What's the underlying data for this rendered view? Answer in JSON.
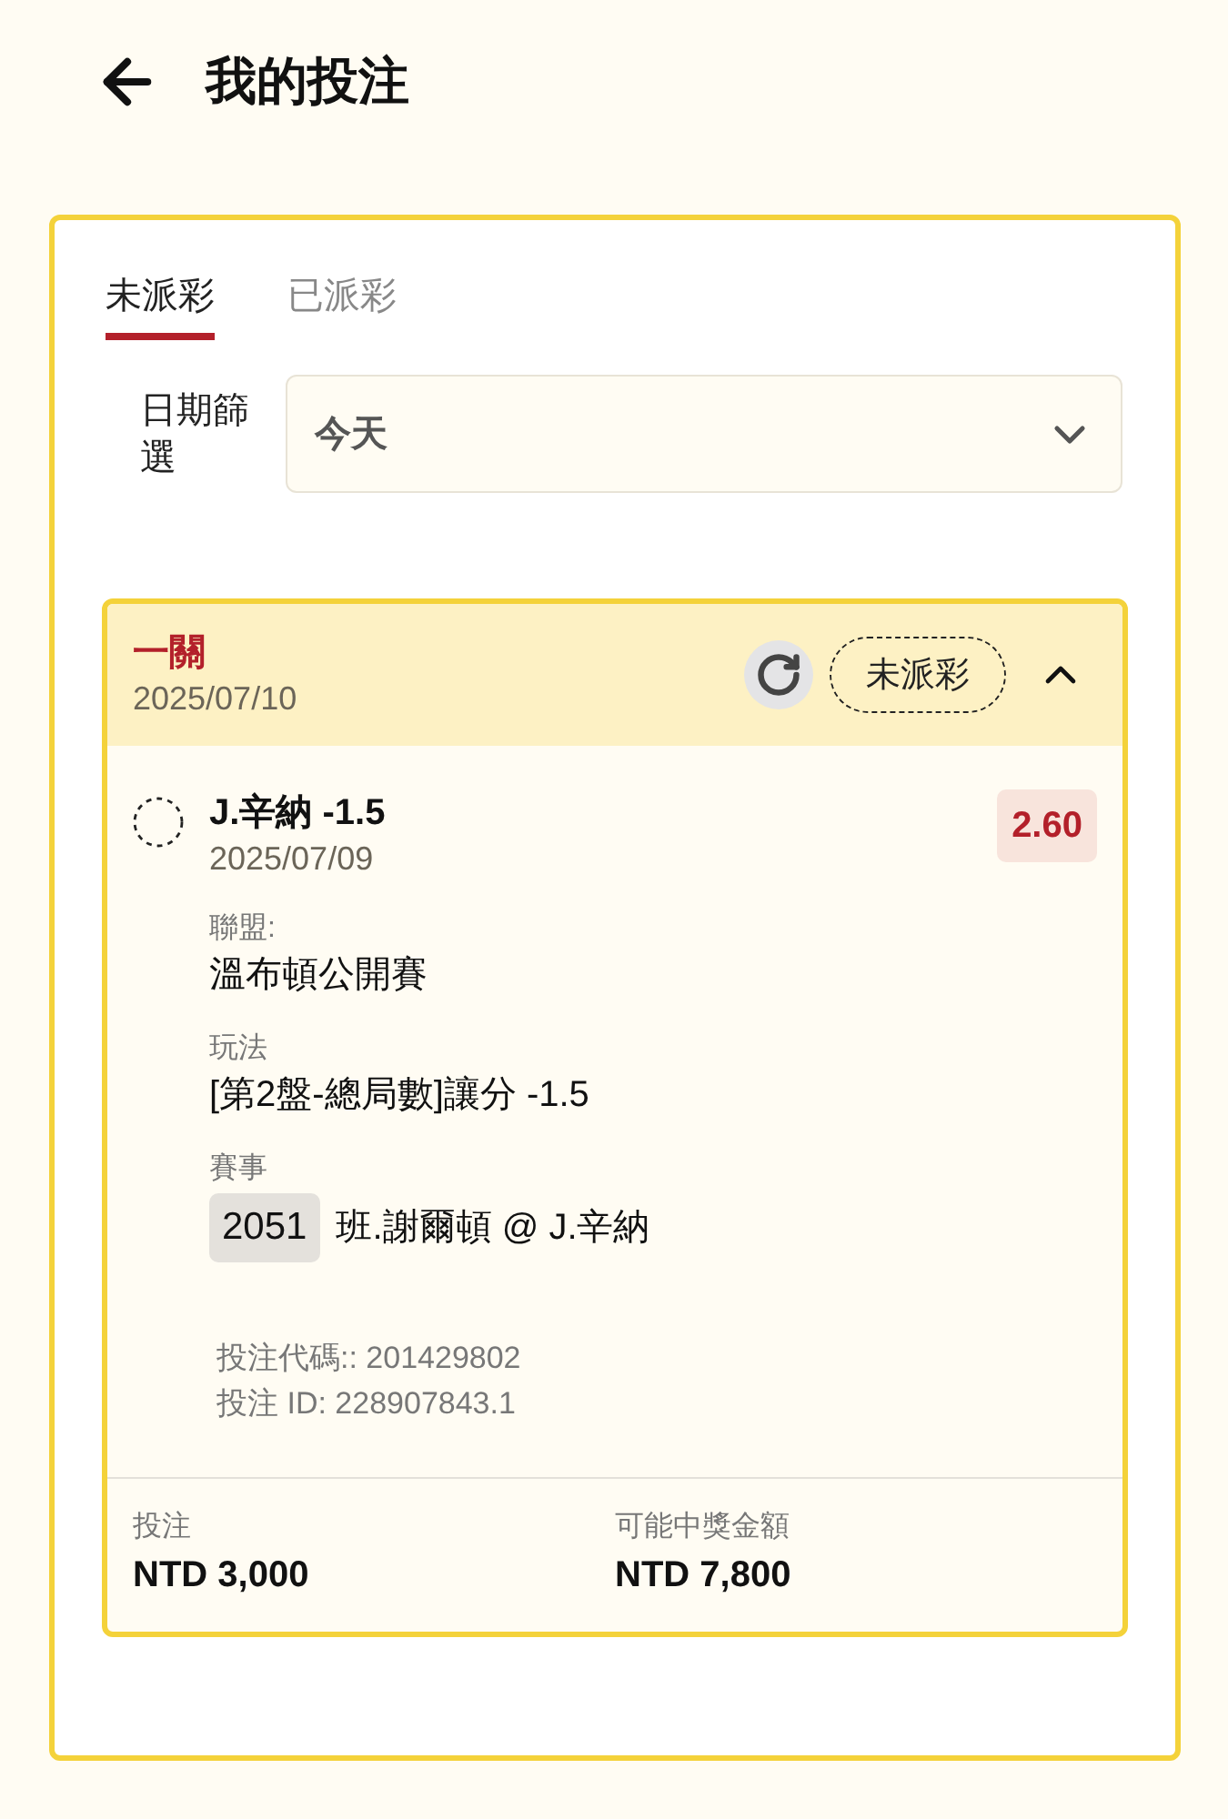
{
  "header": {
    "title": "我的投注"
  },
  "tabs": [
    {
      "label": "未派彩",
      "selected": true
    },
    {
      "label": "已派彩",
      "selected": false
    }
  ],
  "date_filter": {
    "label": "日期篩選",
    "value": "今天"
  },
  "bets": [
    {
      "type": "一關",
      "date": "2025/07/10",
      "status": "未派彩",
      "expanded": true,
      "selections": [
        {
          "name": "J.辛納 -1.5",
          "date": "2025/07/09",
          "odds": "2.60",
          "details": [
            {
              "label": "聯盟:",
              "value": "溫布頓公開賽"
            },
            {
              "label": "玩法",
              "value": "[第2盤-總局數]讓分 -1.5"
            },
            {
              "label": "賽事",
              "code": "2051",
              "value": "班.謝爾頓 @ J.辛納"
            }
          ]
        }
      ],
      "bet_code": "投注代碼:: 201429802",
      "bet_id": "投注 ID: 228907843.1",
      "stake": {
        "label": "投注",
        "value": "NTD 3,000"
      },
      "payout": {
        "label": "可能中獎金額",
        "value": "NTD 7,800"
      }
    }
  ]
}
